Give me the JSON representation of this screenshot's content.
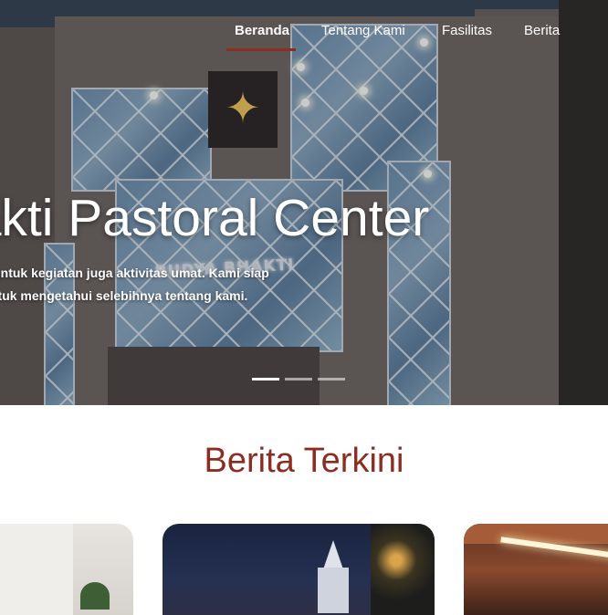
{
  "nav": {
    "items": [
      {
        "label": "Beranda",
        "active": true
      },
      {
        "label": "Tentang Kami",
        "active": false
      },
      {
        "label": "Fasilitas",
        "active": false
      },
      {
        "label": "Berita",
        "active": false
      }
    ]
  },
  "hero": {
    "title": "hakti Pastoral Center",
    "description_line1": "oki untuk kegiatan juga aktivitas umat. Kami siap",
    "description_line2": "h untuk mengetahui selebihnya tentang kami.",
    "building_sign": "BUDYA BHAKTI",
    "slides": {
      "count": 3,
      "active_index": 0
    }
  },
  "news": {
    "title": "Berita Terkini"
  },
  "colors": {
    "accent": "#8c2d21",
    "nav_text": "#ffffff"
  }
}
